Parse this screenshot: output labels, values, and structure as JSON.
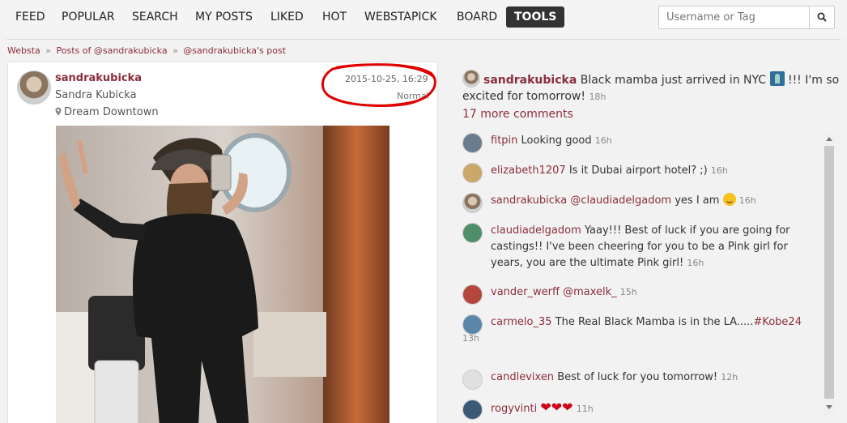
{
  "nav": {
    "items": [
      "FEED",
      "POPULAR",
      "SEARCH",
      "MY POSTS",
      "LIKED",
      "HOT",
      "WEBSTAPICK",
      "BOARD",
      "TOOLS"
    ],
    "active": "TOOLS",
    "search_placeholder": "Username or Tag",
    "search_icon": "search-icon"
  },
  "breadcrumb": {
    "home": "Websta",
    "posts_of": "Posts of @sandrakubicka",
    "current": "@sandrakubicka's post",
    "separator": "»"
  },
  "post": {
    "username": "sandrakubicka",
    "full_name": "Sandra Kubicka",
    "location": "Dream Downtown",
    "date": "2015-10-25, 16:29",
    "filter": "Normal"
  },
  "caption": {
    "username": "sandrakubicka",
    "text_before": "Black mamba just arrived in NYC",
    "text_after": "!!! I'm so excited for tomorrow!",
    "time": "18h"
  },
  "more_comments": "17 more comments",
  "comments": [
    {
      "user": "fitpin",
      "text": "Looking good",
      "time": "16h",
      "avatar_color": "#6a7c8e"
    },
    {
      "user": "elizabeth1207",
      "text": "Is it Dubai airport hotel? ;)",
      "time": "16h",
      "avatar_color": "#c9a86a"
    },
    {
      "user": "sandrakubicka",
      "mention": "@claudiadelgadom",
      "text": "yes I am",
      "time": "16h",
      "avatar_color": "#8a7560"
    },
    {
      "user": "claudiadelgadom",
      "text": "Yaay!!! Best of luck if you are going for castings!! I've been cheering for you to be a Pink girl for years, you are the ultimate Pink girl!",
      "time": "16h",
      "avatar_color": "#4e8f6a"
    },
    {
      "user": "vander_werff",
      "mention": "@maxelk_",
      "text": "",
      "time": "15h",
      "avatar_color": "#b5463c"
    },
    {
      "user": "carmelo_35",
      "text": "The Real Black Mamba is in the LA.....",
      "tag": "#Kobe24",
      "time": "13h",
      "avatar_color": "#5b86a8"
    },
    {
      "user": "candlevixen",
      "text": "Best of luck for you tomorrow!",
      "time": "12h",
      "avatar_color": "#e0e0e0"
    },
    {
      "user": "rogyvinti",
      "text": "❤❤❤",
      "time": "11h",
      "avatar_color": "#3c5a78"
    }
  ]
}
